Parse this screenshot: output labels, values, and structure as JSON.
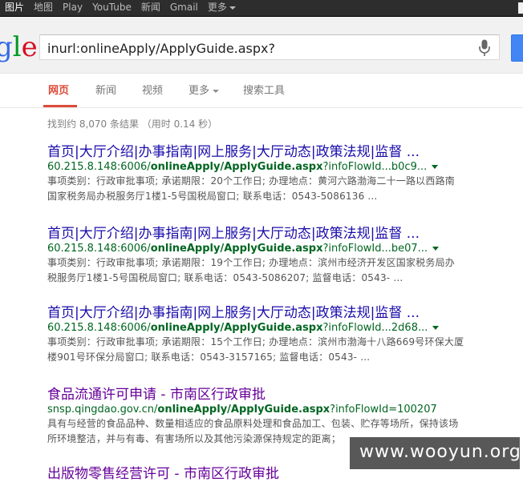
{
  "topbar": {
    "links": [
      "图片",
      "地图",
      "Play",
      "YouTube",
      "新闻",
      "Gmail",
      "更多"
    ]
  },
  "logo": {
    "text_g": "g",
    "text_l": "l",
    "text_e": "e"
  },
  "search": {
    "query": "inurl:onlineApply/ApplyGuide.aspx?"
  },
  "tabs": [
    {
      "label": "网页"
    },
    {
      "label": "新闻"
    },
    {
      "label": "视频"
    },
    {
      "label": "更多"
    },
    {
      "label": "搜索工具"
    }
  ],
  "stats": "找到约 8,070 条结果 （用时 0.14 秒）",
  "results": [
    {
      "title": "首页|大厅介绍|办事指南|网上服务|大厅动态|政策法规|监督 ...",
      "url_prefix": "60.215.8.148:6006/",
      "url_bold": "onlineApply/ApplyGuide.aspx",
      "url_suffix": "?infoFlowId...b0c9...",
      "snippet": "事项类别：行政审批事项; 承诺期限：20个工作日; 办理地点：黄河六路渤海二十一路以西路南国家税务局办税服务厅1楼1-5号国税局窗口; 联系电话：0543-5086136 ..."
    },
    {
      "title": "首页|大厅介绍|办事指南|网上服务|大厅动态|政策法规|监督 ...",
      "url_prefix": "60.215.8.148:6006/",
      "url_bold": "onlineApply/ApplyGuide.aspx",
      "url_suffix": "?infoFlowId...be07...",
      "snippet": "事项类别：行政审批事项; 承诺期限：19个工作日; 办理地点：滨州市经济开发区国家税务局办税服务厅1楼1-5号国税局窗口; 联系电话：0543-5086207; 监督电话：0543- ..."
    },
    {
      "title": "首页|大厅介绍|办事指南|网上服务|大厅动态|政策法规|监督 ...",
      "url_prefix": "60.215.8.148:6006/",
      "url_bold": "onlineApply/ApplyGuide.aspx",
      "url_suffix": "?infoFlowId...2d68...",
      "snippet": "事项类别：行政审批事项; 承诺期限：15个工作日; 办理地点：滨州市渤海十八路669号环保大厦楼901号环保分局窗口; 联系电话：0543-3157165; 监督电话：0543- ..."
    },
    {
      "title": "食品流通许可申请 - 市南区行政审批",
      "url_prefix": "snsp.qingdao.gov.cn/",
      "url_bold": "onlineApply/ApplyGuide.aspx",
      "url_suffix": "?infoFlowId=100207",
      "snippet": "具有与经营的食品品种、数量相适应的食品原料处理和食品加工、包装、贮存等场所，保持该场所环境整洁，并与有毒、有害场所以及其他污染源保持规定的距离；"
    }
  ],
  "partial_title": "出版物零售经营许可 - 市南区行政审批",
  "watermark": "www.wooyun.org"
}
